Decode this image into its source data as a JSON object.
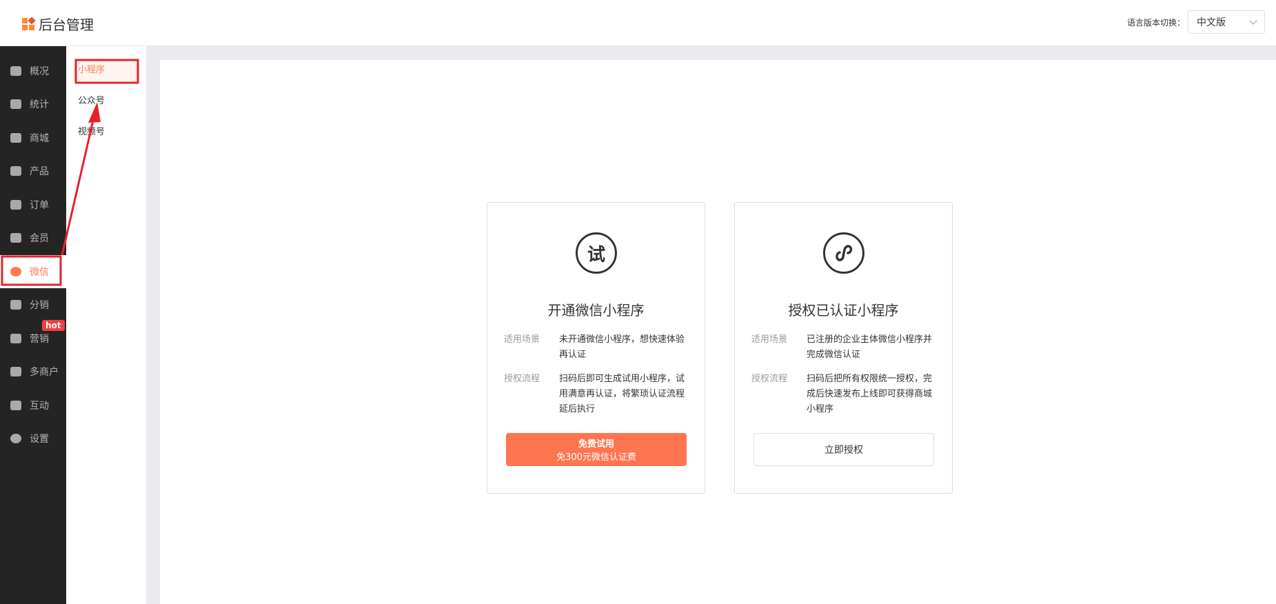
{
  "header": {
    "title": "后台管理",
    "lang_label": "语言版本切换：",
    "lang_value": "中文版"
  },
  "sidebar": {
    "items": [
      {
        "label": "概况",
        "icon": "layers-icon"
      },
      {
        "label": "统计",
        "icon": "chart-icon"
      },
      {
        "label": "商城",
        "icon": "mail-icon"
      },
      {
        "label": "产品",
        "icon": "grid-icon"
      },
      {
        "label": "订单",
        "icon": "clipboard-icon"
      },
      {
        "label": "会员",
        "icon": "crown-icon"
      },
      {
        "label": "微信",
        "icon": "wechat-icon",
        "active": true
      },
      {
        "label": "分销",
        "icon": "users-icon"
      },
      {
        "label": "营销",
        "icon": "flag-icon",
        "badge": "hot"
      },
      {
        "label": "多商户",
        "icon": "store-icon"
      },
      {
        "label": "互动",
        "icon": "people-icon"
      },
      {
        "label": "设置",
        "icon": "gear-icon"
      }
    ]
  },
  "submenu": {
    "items": [
      {
        "label": "小程序",
        "active": true
      },
      {
        "label": "公众号"
      },
      {
        "label": "视频号"
      }
    ]
  },
  "cards": [
    {
      "icon_text": "试",
      "title": "开通微信小程序",
      "rows": [
        {
          "label": "适用场景",
          "text": "未开通微信小程序，想快速体验再认证"
        },
        {
          "label": "授权流程",
          "text": "扫码后即可生成试用小程序，试用满意再认证，将繁琐认证流程延后执行"
        }
      ],
      "button": {
        "label": "免费试用",
        "sub": "免300元微信认证费"
      }
    },
    {
      "icon": "miniprogram-icon",
      "title": "授权已认证小程序",
      "rows": [
        {
          "label": "适用场景",
          "text": "已注册的企业主体微信小程序并完成微信认证"
        },
        {
          "label": "授权流程",
          "text": "扫码后把所有权限统一授权，完成后快速发布上线即可获得商城小程序"
        }
      ],
      "button": {
        "label": "立即授权"
      }
    }
  ],
  "colors": {
    "accent": "#ff7550",
    "sidebar": "#242424",
    "annotation": "#e8202a"
  }
}
